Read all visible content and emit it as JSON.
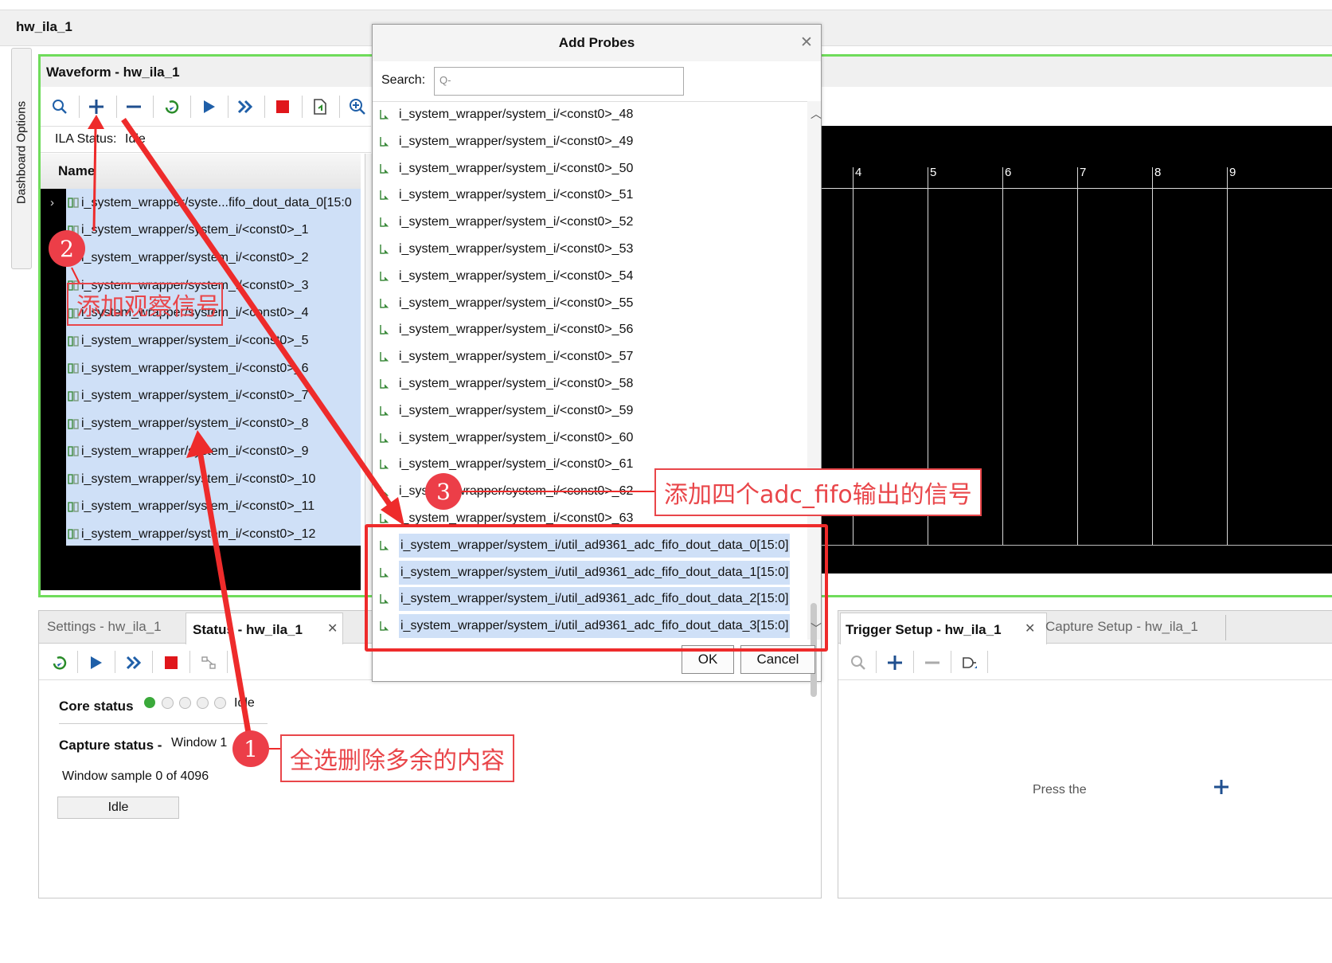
{
  "window_title": "hw_ila_1",
  "side_tab": "Dashboard Options",
  "waveform": {
    "title": "Waveform - hw_ila_1",
    "ila_status_label": "ILA Status:",
    "ila_status_value": "Idle",
    "name_header": "Name",
    "rows": [
      "i_system_wrapper/syste...fifo_dout_data_0[15:0",
      "i_system_wrapper/system_i/<const0>_1",
      "i_system_wrapper/system_i/<const0>_2",
      "i_system_wrapper/system_i/<const0>_3",
      "i_system_wrapper/system_i/<const0>_4",
      "i_system_wrapper/system_i/<const0>_5",
      "i_system_wrapper/system_i/<const0>_6",
      "i_system_wrapper/system_i/<const0>_7",
      "i_system_wrapper/system_i/<const0>_8",
      "i_system_wrapper/system_i/<const0>_9",
      "i_system_wrapper/system_i/<const0>_10",
      "i_system_wrapper/system_i/<const0>_11",
      "i_system_wrapper/system_i/<const0>_12"
    ],
    "timeline_ticks": [
      "4",
      "5",
      "6",
      "7",
      "8",
      "9"
    ]
  },
  "dialog": {
    "title": "Add Probes",
    "search_label": "Search:",
    "search_placeholder": "Q-",
    "probes": [
      "i_system_wrapper/system_i/<const0>_48",
      "i_system_wrapper/system_i/<const0>_49",
      "i_system_wrapper/system_i/<const0>_50",
      "i_system_wrapper/system_i/<const0>_51",
      "i_system_wrapper/system_i/<const0>_52",
      "i_system_wrapper/system_i/<const0>_53",
      "i_system_wrapper/system_i/<const0>_54",
      "i_system_wrapper/system_i/<const0>_55",
      "i_system_wrapper/system_i/<const0>_56",
      "i_system_wrapper/system_i/<const0>_57",
      "i_system_wrapper/system_i/<const0>_58",
      "i_system_wrapper/system_i/<const0>_59",
      "i_system_wrapper/system_i/<const0>_60",
      "i_system_wrapper/system_i/<const0>_61",
      "i_system_wrapper/system_i/<const0>_62",
      "i_system_wrapper/system_i/<const0>_63"
    ],
    "selected_probes": [
      "i_system_wrapper/system_i/util_ad9361_adc_fifo_dout_data_0[15:0]",
      "i_system_wrapper/system_i/util_ad9361_adc_fifo_dout_data_1[15:0]",
      "i_system_wrapper/system_i/util_ad9361_adc_fifo_dout_data_2[15:0]",
      "i_system_wrapper/system_i/util_ad9361_adc_fifo_dout_data_3[15:0]"
    ],
    "ok_label": "OK",
    "cancel_label": "Cancel"
  },
  "bottom_left": {
    "tab_settings": "Settings - hw_ila_1",
    "tab_status": "Status - hw_ila_1",
    "core_status_label": "Core status",
    "core_status_value": "Idle",
    "capture_status_label": "Capture status -",
    "capture_status_value": "Window 1",
    "window_sample": "Window sample 0 of 4096",
    "idle_label": "Idle"
  },
  "bottom_right": {
    "tab_trigger": "Trigger Setup - hw_ila_1",
    "tab_capture": "Capture Setup - hw_ila_1",
    "hint_text": "Press the"
  },
  "annotations": {
    "badge1": "1",
    "badge2": "2",
    "badge3": "3",
    "callout1": "全选删除多余的内容",
    "callout2": "添加观察信号",
    "callout3": "添加四个adc_fifo输出的信号"
  },
  "colors": {
    "accent_green": "#6fdc5b",
    "selection_blue": "#cfe0f7",
    "annotation_red": "#e9464a",
    "toolbar_blue": "#1f5fa8",
    "stop_red": "#e0161b"
  }
}
